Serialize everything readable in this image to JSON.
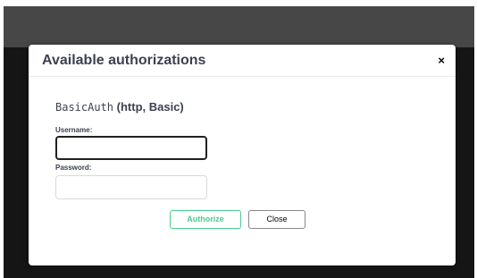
{
  "modal": {
    "title": "Available authorizations",
    "close_icon": "×"
  },
  "auth": {
    "scheme_name": "BasicAuth",
    "scheme_type": " (http, Basic)",
    "username_label": "Username:",
    "username_value": "",
    "password_label": "Password:",
    "password_value": ""
  },
  "buttons": {
    "authorize_label": "Authorize",
    "close_label": "Close"
  },
  "colors": {
    "authorize_accent": "#49cc90",
    "title_text": "#3b4151",
    "overlay": "#151515"
  }
}
